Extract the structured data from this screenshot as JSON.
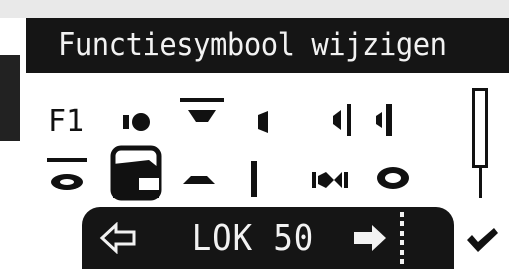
{
  "header": {
    "title": "Functiesymbool wijzigen"
  },
  "grid": {
    "row1_first_label": "F1",
    "icons_row1": [
      "function-key-label",
      "sound-icon",
      "headlight-icon",
      "left-speaker-icon",
      "horn-icon",
      "speaker-icon"
    ],
    "icons_row2": [
      "lamp-icon",
      "selected-symbol-icon",
      "coupler-icon",
      "pantograph-icon",
      "buffer-icon",
      "fan-icon"
    ],
    "selected": "selected-symbol-icon"
  },
  "footer": {
    "loco_name": "LOK 50",
    "prev_label": "previous",
    "next_label": "next"
  },
  "colors": {
    "bar_bg": "#151515",
    "bar_fg": "#f2f2f2",
    "ink": "#111111"
  }
}
